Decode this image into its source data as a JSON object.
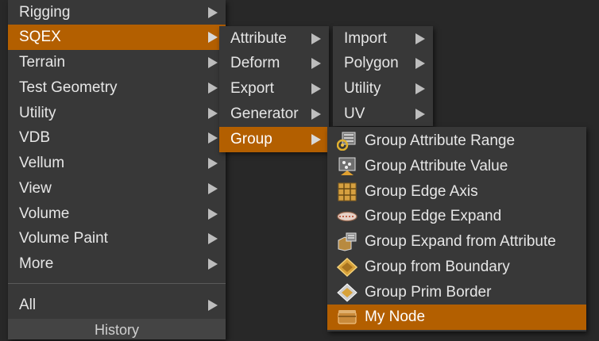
{
  "menu1": {
    "items": [
      "Rigging",
      "SQEX",
      "Terrain",
      "Test Geometry",
      "Utility",
      "VDB",
      "Vellum",
      "View",
      "Volume",
      "Volume Paint",
      "More"
    ],
    "all": "All",
    "history": "History"
  },
  "menu2": {
    "items": [
      "Attribute",
      "Deform",
      "Export",
      "Generator",
      "Group"
    ]
  },
  "menu3": {
    "items": [
      "Import",
      "Polygon",
      "Utility",
      "UV"
    ]
  },
  "menu4": {
    "items": [
      {
        "label": "Group Attribute Range",
        "icon": "group-attribute-range-icon"
      },
      {
        "label": "Group Attribute Value",
        "icon": "group-attribute-value-icon"
      },
      {
        "label": "Group Edge Axis",
        "icon": "group-edge-axis-icon"
      },
      {
        "label": "Group Edge Expand",
        "icon": "group-edge-expand-icon"
      },
      {
        "label": "Group Expand from Attribute",
        "icon": "group-expand-from-attribute-icon"
      },
      {
        "label": "Group from Boundary",
        "icon": "group-from-boundary-icon"
      },
      {
        "label": "Group Prim Border",
        "icon": "group-prim-border-icon"
      },
      {
        "label": "My Node",
        "icon": "my-node-icon"
      }
    ]
  },
  "colors": {
    "background": "#282828",
    "menu": "#383838",
    "highlight": "#b35f00",
    "text": "#e6e6e6"
  }
}
